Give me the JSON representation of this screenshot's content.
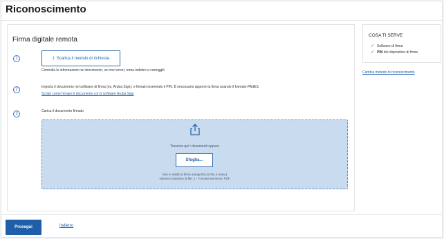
{
  "page": {
    "title": "Riconoscimento"
  },
  "card": {
    "title": "Firma digitale remota",
    "steps": [
      {
        "number": "1",
        "button_label": "Scarica il modulo di richiesta",
        "button_icon": "download-icon",
        "text": "Controlla le informazioni nel documento, se trovi errori, torna indietro e correggili."
      },
      {
        "number": "2",
        "text": "Importa il documento nel software di firma (es. Aruba Sign), e firmalo inserendo il PIN. È necessario apporre la firma usando il formato PAdES.",
        "link": "Scopri come firmare il documento con il software Aruba Sign"
      },
      {
        "number": "3",
        "text": "Carica il documento firmato"
      }
    ],
    "dropzone": {
      "icon": "upload-icon",
      "text": "Trascina qui i documenti oppure",
      "button_label": "Sfoglia...",
      "note1": "Non è valida la firma autografa (scritta a mano)",
      "note2": "Numero massimo di file: 1 - Formati ammessi: PDF"
    }
  },
  "sidebar": {
    "title": "COSA TI SERVE",
    "items": [
      {
        "bold": "",
        "text": "Software di firma"
      },
      {
        "bold": "PIN",
        "text": "del dispositivo di firma"
      }
    ],
    "link": "Cambia metodo di riconoscimento"
  },
  "footer": {
    "primary_label": "Prosegui",
    "back_label": "Indietro"
  },
  "colors": {
    "primary": "#1f5ea8",
    "dropzone_bg": "#c9dcef",
    "check": "#2f8a3a"
  }
}
